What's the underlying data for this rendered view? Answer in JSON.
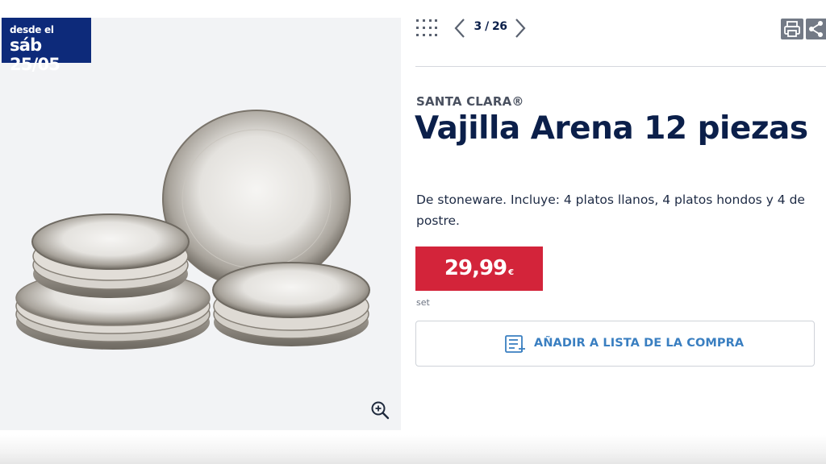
{
  "badge": {
    "line1": "desde el",
    "line2": "sáb 25/05"
  },
  "navigation": {
    "counter": "3 / 26"
  },
  "product": {
    "brand": "SANTA CLARA®",
    "title": "Vajilla Arena 12 piezas",
    "description": "De stoneware. Incluye: 4 platos llanos, 4 platos hondos y 4 de postre.",
    "price": "29,99",
    "currency": "€",
    "unit": "set"
  },
  "actions": {
    "add_to_list": "AÑADIR A LISTA DE LA COMPRA"
  },
  "icons": {
    "grid": "grid-icon",
    "prev": "chevron-left-icon",
    "next": "chevron-right-icon",
    "print": "printer-icon",
    "share": "share-icon",
    "zoom": "zoom-in-icon",
    "list": "list-add-icon"
  },
  "colors": {
    "navy": "#0b1f4a",
    "badge": "#0d2a7a",
    "price": "#d3243a",
    "link": "#3a7fc1"
  }
}
